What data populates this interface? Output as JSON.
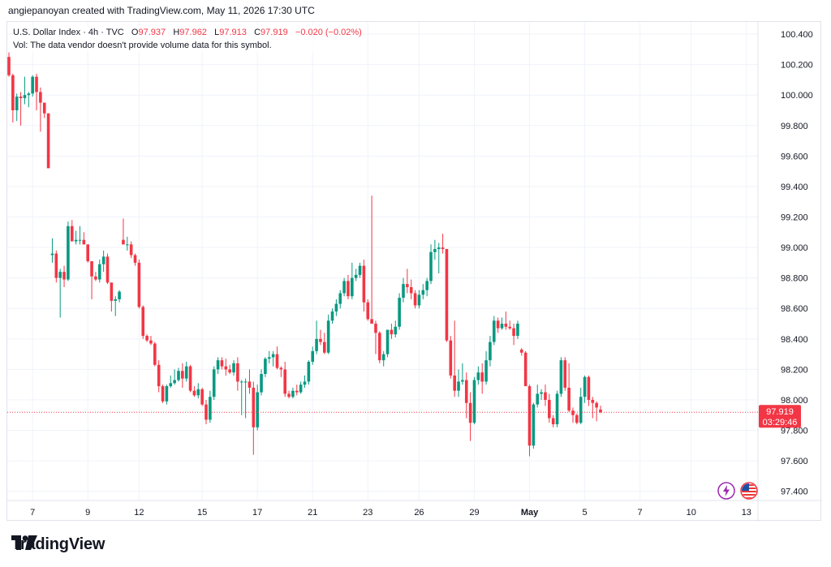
{
  "header": {
    "text": "angiepanoyan created with TradingView.com, May 11, 2026 17:30 UTC"
  },
  "legend": {
    "symbol": "U.S. Dollar Index · 4h · TVC",
    "o_label": "O",
    "o_value": "97.937",
    "h_label": "H",
    "h_value": "97.962",
    "l_label": "L",
    "l_value": "97.913",
    "c_label": "C",
    "c_value": "97.919",
    "change": "−0.020 (−0.02%)",
    "volume_note": "Vol: The data vendor doesn't provide volume data for this symbol."
  },
  "price_tag": {
    "price": "97.919",
    "countdown": "03:29:46"
  },
  "footer": {
    "brand": "TradingView"
  },
  "colors": {
    "up": "#089981",
    "down": "#f23645",
    "grid": "#f0f3fa",
    "axis_text": "#131722"
  },
  "icons": [
    "lightning-icon",
    "us-flag-icon",
    "tradingview-logo-icon"
  ],
  "chart_data": {
    "type": "candlestick",
    "title": "U.S. Dollar Index · 4h · TVC",
    "ylim": [
      97.34,
      100.48
    ],
    "y_ticks": [
      "97.400",
      "97.600",
      "97.800",
      "98.000",
      "98.200",
      "98.400",
      "98.600",
      "98.800",
      "99.000",
      "99.200",
      "99.400",
      "99.600",
      "99.800",
      "100.000",
      "100.200",
      "100.400"
    ],
    "y_tick_values": [
      97.4,
      97.6,
      97.8,
      98.0,
      98.2,
      98.4,
      98.6,
      98.8,
      99.0,
      99.2,
      99.4,
      99.6,
      99.8,
      100.0,
      100.2,
      100.4
    ],
    "x_ticks": [
      {
        "label": "7",
        "bar": 6
      },
      {
        "label": "9",
        "bar": 20
      },
      {
        "label": "12",
        "bar": 33
      },
      {
        "label": "15",
        "bar": 49
      },
      {
        "label": "17",
        "bar": 63
      },
      {
        "label": "21",
        "bar": 77
      },
      {
        "label": "23",
        "bar": 91
      },
      {
        "label": "26",
        "bar": 104
      },
      {
        "label": "29",
        "bar": 118
      },
      {
        "label": "May",
        "bar": 132
      },
      {
        "label": "5",
        "bar": 146
      },
      {
        "label": "7",
        "bar": 160
      },
      {
        "label": "10",
        "bar": 173
      },
      {
        "label": "13",
        "bar": 187
      }
    ],
    "grid": true,
    "last_price": 97.919,
    "candles": [
      {
        "o": 100.25,
        "h": 100.28,
        "l": 100.12,
        "c": 100.13
      },
      {
        "o": 100.13,
        "h": 100.14,
        "l": 99.82,
        "c": 99.9
      },
      {
        "o": 99.9,
        "h": 100.01,
        "l": 99.83,
        "c": 99.99
      },
      {
        "o": 99.99,
        "h": 100.02,
        "l": 99.8,
        "c": 99.98
      },
      {
        "o": 99.98,
        "h": 100.12,
        "l": 99.94,
        "c": 100.0
      },
      {
        "o": 100.0,
        "h": 100.02,
        "l": 99.92,
        "c": 100.01
      },
      {
        "o": 100.01,
        "h": 100.13,
        "l": 99.99,
        "c": 100.12
      },
      {
        "o": 100.12,
        "h": 100.14,
        "l": 99.9,
        "c": 100.02
      },
      {
        "o": 100.02,
        "h": 100.05,
        "l": 99.76,
        "c": 99.95
      },
      {
        "o": 99.95,
        "h": 99.95,
        "l": 99.85,
        "c": 99.88
      },
      {
        "o": 99.88,
        "h": 99.88,
        "l": 99.52,
        "c": 99.52
      },
      {
        "o": 98.95,
        "h": 99.06,
        "l": 98.9,
        "c": 98.96
      },
      {
        "o": 98.96,
        "h": 98.98,
        "l": 98.77,
        "c": 98.8
      },
      {
        "o": 98.8,
        "h": 98.86,
        "l": 98.54,
        "c": 98.84
      },
      {
        "o": 98.84,
        "h": 98.88,
        "l": 98.74,
        "c": 98.79
      },
      {
        "o": 98.79,
        "h": 99.17,
        "l": 98.78,
        "c": 99.14
      },
      {
        "o": 99.14,
        "h": 99.18,
        "l": 99.04,
        "c": 99.04
      },
      {
        "o": 99.04,
        "h": 99.11,
        "l": 99.02,
        "c": 99.05
      },
      {
        "o": 99.05,
        "h": 99.14,
        "l": 99.02,
        "c": 99.05
      },
      {
        "o": 99.05,
        "h": 99.1,
        "l": 99.02,
        "c": 99.02
      },
      {
        "o": 99.02,
        "h": 99.02,
        "l": 98.9,
        "c": 98.91
      },
      {
        "o": 98.91,
        "h": 98.91,
        "l": 98.66,
        "c": 98.81
      },
      {
        "o": 98.81,
        "h": 98.84,
        "l": 98.78,
        "c": 98.79
      },
      {
        "o": 98.79,
        "h": 98.92,
        "l": 98.77,
        "c": 98.89
      },
      {
        "o": 98.89,
        "h": 98.98,
        "l": 98.84,
        "c": 98.94
      },
      {
        "o": 98.94,
        "h": 98.96,
        "l": 98.76,
        "c": 98.77
      },
      {
        "o": 98.77,
        "h": 98.77,
        "l": 98.58,
        "c": 98.65
      },
      {
        "o": 98.65,
        "h": 98.68,
        "l": 98.55,
        "c": 98.66
      },
      {
        "o": 98.66,
        "h": 98.72,
        "l": 98.64,
        "c": 98.71
      },
      {
        "o": 99.05,
        "h": 99.19,
        "l": 99.03,
        "c": 99.02
      },
      {
        "o": 99.02,
        "h": 99.07,
        "l": 98.98,
        "c": 99.02
      },
      {
        "o": 99.02,
        "h": 99.04,
        "l": 98.93,
        "c": 98.95
      },
      {
        "o": 98.95,
        "h": 98.96,
        "l": 98.88,
        "c": 98.9
      },
      {
        "o": 98.9,
        "h": 98.92,
        "l": 98.6,
        "c": 98.61
      },
      {
        "o": 98.61,
        "h": 98.62,
        "l": 98.4,
        "c": 98.42
      },
      {
        "o": 98.42,
        "h": 98.43,
        "l": 98.38,
        "c": 98.39
      },
      {
        "o": 98.39,
        "h": 98.42,
        "l": 98.36,
        "c": 98.37
      },
      {
        "o": 98.37,
        "h": 98.38,
        "l": 98.22,
        "c": 98.23
      },
      {
        "o": 98.23,
        "h": 98.26,
        "l": 98.05,
        "c": 98.09
      },
      {
        "o": 98.09,
        "h": 98.1,
        "l": 97.98,
        "c": 97.99
      },
      {
        "o": 97.99,
        "h": 98.1,
        "l": 97.97,
        "c": 98.09
      },
      {
        "o": 98.09,
        "h": 98.16,
        "l": 98.08,
        "c": 98.11
      },
      {
        "o": 98.11,
        "h": 98.2,
        "l": 98.1,
        "c": 98.13
      },
      {
        "o": 98.13,
        "h": 98.21,
        "l": 98.12,
        "c": 98.19
      },
      {
        "o": 98.19,
        "h": 98.24,
        "l": 98.08,
        "c": 98.14
      },
      {
        "o": 98.14,
        "h": 98.25,
        "l": 98.12,
        "c": 98.22
      },
      {
        "o": 98.22,
        "h": 98.23,
        "l": 98.05,
        "c": 98.06
      },
      {
        "o": 98.06,
        "h": 98.09,
        "l": 98.02,
        "c": 98.03
      },
      {
        "o": 98.03,
        "h": 98.11,
        "l": 98.01,
        "c": 98.07
      },
      {
        "o": 98.07,
        "h": 98.08,
        "l": 97.96,
        "c": 97.97
      },
      {
        "o": 97.97,
        "h": 98.0,
        "l": 97.84,
        "c": 97.87
      },
      {
        "o": 97.87,
        "h": 98.06,
        "l": 97.85,
        "c": 98.02
      },
      {
        "o": 98.02,
        "h": 98.22,
        "l": 98.0,
        "c": 98.2
      },
      {
        "o": 98.2,
        "h": 98.28,
        "l": 98.17,
        "c": 98.26
      },
      {
        "o": 98.26,
        "h": 98.28,
        "l": 98.2,
        "c": 98.22
      },
      {
        "o": 98.22,
        "h": 98.27,
        "l": 98.16,
        "c": 98.2
      },
      {
        "o": 98.2,
        "h": 98.23,
        "l": 98.17,
        "c": 98.18
      },
      {
        "o": 98.18,
        "h": 98.26,
        "l": 98.16,
        "c": 98.24
      },
      {
        "o": 98.24,
        "h": 98.28,
        "l": 98.06,
        "c": 98.12
      },
      {
        "o": 98.12,
        "h": 98.13,
        "l": 97.9,
        "c": 98.12
      },
      {
        "o": 98.12,
        "h": 98.14,
        "l": 97.88,
        "c": 98.12
      },
      {
        "o": 98.12,
        "h": 98.2,
        "l": 98.04,
        "c": 98.08
      },
      {
        "o": 98.08,
        "h": 98.12,
        "l": 97.64,
        "c": 97.82
      },
      {
        "o": 97.82,
        "h": 98.1,
        "l": 97.8,
        "c": 98.05
      },
      {
        "o": 98.05,
        "h": 98.2,
        "l": 98.03,
        "c": 98.17
      },
      {
        "o": 98.17,
        "h": 98.28,
        "l": 98.15,
        "c": 98.27
      },
      {
        "o": 98.27,
        "h": 98.32,
        "l": 98.24,
        "c": 98.28
      },
      {
        "o": 98.28,
        "h": 98.32,
        "l": 98.22,
        "c": 98.3
      },
      {
        "o": 98.3,
        "h": 98.35,
        "l": 98.2,
        "c": 98.21
      },
      {
        "o": 98.21,
        "h": 98.22,
        "l": 98.15,
        "c": 98.2
      },
      {
        "o": 98.2,
        "h": 98.25,
        "l": 98.02,
        "c": 98.04
      },
      {
        "o": 98.04,
        "h": 98.06,
        "l": 98.01,
        "c": 98.02
      },
      {
        "o": 98.02,
        "h": 98.08,
        "l": 98.01,
        "c": 98.06
      },
      {
        "o": 98.06,
        "h": 98.1,
        "l": 98.03,
        "c": 98.05
      },
      {
        "o": 98.05,
        "h": 98.12,
        "l": 98.04,
        "c": 98.1
      },
      {
        "o": 98.1,
        "h": 98.16,
        "l": 98.08,
        "c": 98.12
      },
      {
        "o": 98.12,
        "h": 98.26,
        "l": 98.1,
        "c": 98.25
      },
      {
        "o": 98.25,
        "h": 98.35,
        "l": 98.23,
        "c": 98.32
      },
      {
        "o": 98.32,
        "h": 98.52,
        "l": 98.3,
        "c": 98.4
      },
      {
        "o": 98.4,
        "h": 98.46,
        "l": 98.36,
        "c": 98.38
      },
      {
        "o": 98.38,
        "h": 98.44,
        "l": 98.3,
        "c": 98.31
      },
      {
        "o": 98.31,
        "h": 98.56,
        "l": 98.3,
        "c": 98.52
      },
      {
        "o": 98.52,
        "h": 98.6,
        "l": 98.5,
        "c": 98.58
      },
      {
        "o": 98.58,
        "h": 98.66,
        "l": 98.55,
        "c": 98.63
      },
      {
        "o": 98.63,
        "h": 98.72,
        "l": 98.6,
        "c": 98.7
      },
      {
        "o": 98.7,
        "h": 98.8,
        "l": 98.68,
        "c": 98.78
      },
      {
        "o": 98.78,
        "h": 98.82,
        "l": 98.66,
        "c": 98.68
      },
      {
        "o": 98.68,
        "h": 98.9,
        "l": 98.66,
        "c": 98.8
      },
      {
        "o": 98.8,
        "h": 98.86,
        "l": 98.78,
        "c": 98.82
      },
      {
        "o": 98.82,
        "h": 98.9,
        "l": 98.8,
        "c": 98.88
      },
      {
        "o": 98.88,
        "h": 98.92,
        "l": 98.58,
        "c": 98.64
      },
      {
        "o": 98.64,
        "h": 98.66,
        "l": 98.52,
        "c": 98.53
      },
      {
        "o": 98.53,
        "h": 99.34,
        "l": 98.5,
        "c": 98.5
      },
      {
        "o": 98.5,
        "h": 98.52,
        "l": 98.3,
        "c": 98.44
      },
      {
        "o": 98.44,
        "h": 98.45,
        "l": 98.24,
        "c": 98.26
      },
      {
        "o": 98.26,
        "h": 98.32,
        "l": 98.22,
        "c": 98.3
      },
      {
        "o": 98.3,
        "h": 98.46,
        "l": 98.28,
        "c": 98.46
      },
      {
        "o": 98.46,
        "h": 98.5,
        "l": 98.4,
        "c": 98.43
      },
      {
        "o": 98.43,
        "h": 98.52,
        "l": 98.41,
        "c": 98.48
      },
      {
        "o": 98.48,
        "h": 98.7,
        "l": 98.46,
        "c": 98.67
      },
      {
        "o": 98.67,
        "h": 98.8,
        "l": 98.64,
        "c": 98.76
      },
      {
        "o": 98.76,
        "h": 98.86,
        "l": 98.7,
        "c": 98.74
      },
      {
        "o": 98.74,
        "h": 98.79,
        "l": 98.66,
        "c": 98.7
      },
      {
        "o": 98.7,
        "h": 98.72,
        "l": 98.6,
        "c": 98.62
      },
      {
        "o": 98.62,
        "h": 98.72,
        "l": 98.6,
        "c": 98.69
      },
      {
        "o": 98.69,
        "h": 98.76,
        "l": 98.66,
        "c": 98.72
      },
      {
        "o": 98.72,
        "h": 98.8,
        "l": 98.68,
        "c": 98.78
      },
      {
        "o": 98.78,
        "h": 99.02,
        "l": 98.76,
        "c": 98.97
      },
      {
        "o": 98.97,
        "h": 99.05,
        "l": 98.92,
        "c": 98.99
      },
      {
        "o": 98.99,
        "h": 99.03,
        "l": 98.83,
        "c": 99.0
      },
      {
        "o": 99.0,
        "h": 99.09,
        "l": 98.96,
        "c": 98.99
      },
      {
        "o": 98.99,
        "h": 98.99,
        "l": 98.38,
        "c": 98.39
      },
      {
        "o": 98.39,
        "h": 98.42,
        "l": 98.14,
        "c": 98.16
      },
      {
        "o": 98.16,
        "h": 98.52,
        "l": 98.02,
        "c": 98.06
      },
      {
        "o": 98.06,
        "h": 98.2,
        "l": 98.02,
        "c": 98.12
      },
      {
        "o": 98.12,
        "h": 98.24,
        "l": 98.1,
        "c": 98.13
      },
      {
        "o": 98.13,
        "h": 98.18,
        "l": 97.88,
        "c": 97.98
      },
      {
        "o": 97.98,
        "h": 98.05,
        "l": 97.73,
        "c": 97.85
      },
      {
        "o": 97.85,
        "h": 98.15,
        "l": 97.84,
        "c": 98.13
      },
      {
        "o": 98.13,
        "h": 98.22,
        "l": 98.1,
        "c": 98.18
      },
      {
        "o": 98.18,
        "h": 98.24,
        "l": 98.04,
        "c": 98.12
      },
      {
        "o": 98.12,
        "h": 98.32,
        "l": 98.1,
        "c": 98.26
      },
      {
        "o": 98.26,
        "h": 98.42,
        "l": 98.22,
        "c": 98.38
      },
      {
        "o": 98.38,
        "h": 98.55,
        "l": 98.36,
        "c": 98.52
      },
      {
        "o": 98.52,
        "h": 98.54,
        "l": 98.44,
        "c": 98.47
      },
      {
        "o": 98.47,
        "h": 98.54,
        "l": 98.46,
        "c": 98.5
      },
      {
        "o": 98.5,
        "h": 98.58,
        "l": 98.46,
        "c": 98.48
      },
      {
        "o": 98.48,
        "h": 98.52,
        "l": 98.46,
        "c": 98.47
      },
      {
        "o": 98.47,
        "h": 98.5,
        "l": 98.36,
        "c": 98.42
      },
      {
        "o": 98.42,
        "h": 98.52,
        "l": 98.4,
        "c": 98.5
      },
      {
        "o": 98.33,
        "h": 98.34,
        "l": 98.29,
        "c": 98.31
      },
      {
        "o": 98.31,
        "h": 98.32,
        "l": 98.09,
        "c": 98.09
      },
      {
        "o": 98.09,
        "h": 98.1,
        "l": 97.63,
        "c": 97.7
      },
      {
        "o": 97.7,
        "h": 97.98,
        "l": 97.68,
        "c": 97.97
      },
      {
        "o": 97.97,
        "h": 98.1,
        "l": 97.95,
        "c": 98.04
      },
      {
        "o": 98.04,
        "h": 98.07,
        "l": 98.0,
        "c": 98.05
      },
      {
        "o": 98.05,
        "h": 98.1,
        "l": 97.96,
        "c": 98.0
      },
      {
        "o": 98.0,
        "h": 98.04,
        "l": 97.85,
        "c": 97.88
      },
      {
        "o": 97.88,
        "h": 97.9,
        "l": 97.82,
        "c": 97.84
      },
      {
        "o": 97.84,
        "h": 98.06,
        "l": 97.82,
        "c": 98.04
      },
      {
        "o": 98.04,
        "h": 98.28,
        "l": 98.02,
        "c": 98.26
      },
      {
        "o": 98.26,
        "h": 98.28,
        "l": 98.06,
        "c": 98.08
      },
      {
        "o": 98.08,
        "h": 98.24,
        "l": 97.92,
        "c": 97.93
      },
      {
        "o": 97.93,
        "h": 97.95,
        "l": 97.85,
        "c": 97.9
      },
      {
        "o": 97.9,
        "h": 97.91,
        "l": 97.84,
        "c": 97.85
      },
      {
        "o": 97.85,
        "h": 98.08,
        "l": 97.84,
        "c": 98.02
      },
      {
        "o": 98.02,
        "h": 98.16,
        "l": 97.98,
        "c": 98.15
      },
      {
        "o": 98.15,
        "h": 98.16,
        "l": 97.96,
        "c": 98.0
      },
      {
        "o": 98.0,
        "h": 98.02,
        "l": 97.88,
        "c": 97.98
      },
      {
        "o": 97.98,
        "h": 97.99,
        "l": 97.86,
        "c": 97.95
      },
      {
        "o": 97.937,
        "h": 97.962,
        "l": 97.913,
        "c": 97.919
      }
    ]
  }
}
